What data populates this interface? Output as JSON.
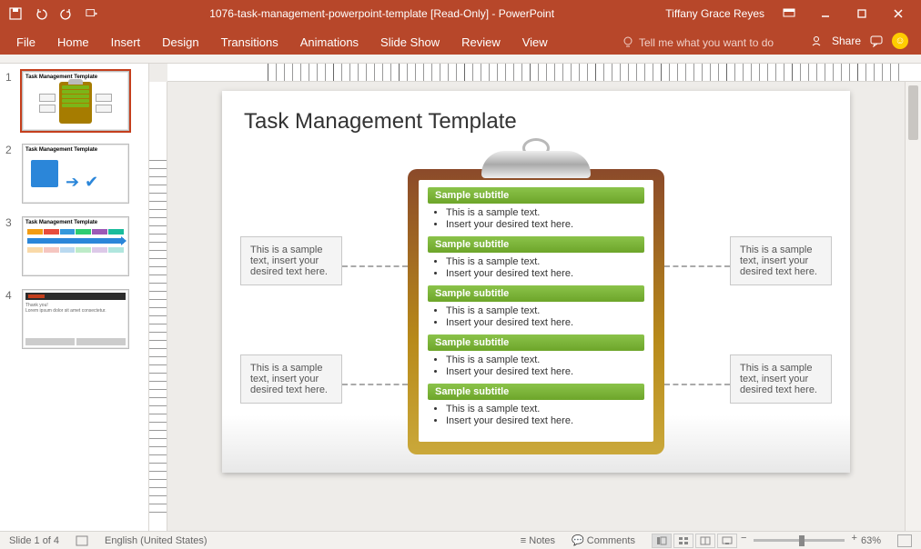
{
  "titlebar": {
    "document_title": "1076-task-management-powerpoint-template [Read-Only]  -  PowerPoint",
    "username": "Tiffany Grace Reyes"
  },
  "ribbon": {
    "tabs": [
      "File",
      "Home",
      "Insert",
      "Design",
      "Transitions",
      "Animations",
      "Slide Show",
      "Review",
      "View"
    ],
    "tellme_placeholder": "Tell me what you want to do",
    "share_label": "Share"
  },
  "thumbnails": {
    "count": 4,
    "selected_index": 1,
    "slide1_title": "Task Management Template",
    "slide2_title": "Task Management Template",
    "slide3_title": "Task Management Template",
    "slide4_title": "Thank you!"
  },
  "slide": {
    "title": "Task Management Template",
    "sections": [
      {
        "heading": "Sample subtitle",
        "bullets": [
          "This is a sample text.",
          "Insert your desired text here."
        ]
      },
      {
        "heading": "Sample subtitle",
        "bullets": [
          "This is a sample text.",
          "Insert your desired text here."
        ]
      },
      {
        "heading": "Sample subtitle",
        "bullets": [
          "This is a sample text.",
          "Insert your desired text here."
        ]
      },
      {
        "heading": "Sample subtitle",
        "bullets": [
          "This is a sample text.",
          "Insert your desired text here."
        ]
      },
      {
        "heading": "Sample subtitle",
        "bullets": [
          "This is a sample text.",
          "Insert your desired text here."
        ]
      }
    ],
    "callout_text": "This is a sample text, insert your desired text here."
  },
  "statusbar": {
    "slide_indicator": "Slide 1 of 4",
    "language": "English (United States)",
    "notes_label": "Notes",
    "comments_label": "Comments",
    "zoom_level": "63%"
  },
  "colors": {
    "brand": "#b7472a",
    "accent_green": "#7cb518",
    "clipboard_wood": "#a67c00"
  }
}
